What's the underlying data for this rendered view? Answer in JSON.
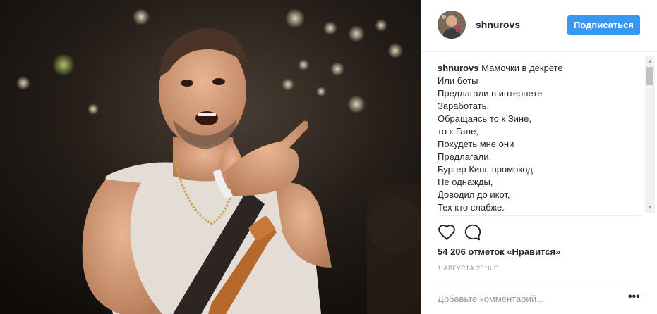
{
  "post": {
    "username": "shnurovs",
    "follow_label": "Подписаться",
    "caption_user": "shnurovs",
    "caption_lines": [
      "Мамочки в декрете",
      "Или боты",
      "Предлагали в интернете",
      "Заработать.",
      "Обращаясь то к Зине,",
      "то к Гале,",
      "Похудеть мне они",
      "Предлагали.",
      "Бургер Кинг, промокод",
      "Не однажды,",
      "Доводил до икот,",
      "Тех кто слабже."
    ],
    "likes_text": "54 206 отметок «Нравится»",
    "date_text": "1 АВГУСТА 2016 Г.",
    "comment_placeholder": "Добавьте комментарий...",
    "more_label": "•••"
  },
  "icons": {
    "like": "heart-icon",
    "comment": "comment-bubble-icon",
    "more": "more-options-icon"
  },
  "colors": {
    "accent": "#3897f0",
    "text": "#262626",
    "muted": "#999999",
    "border": "#efefef"
  }
}
